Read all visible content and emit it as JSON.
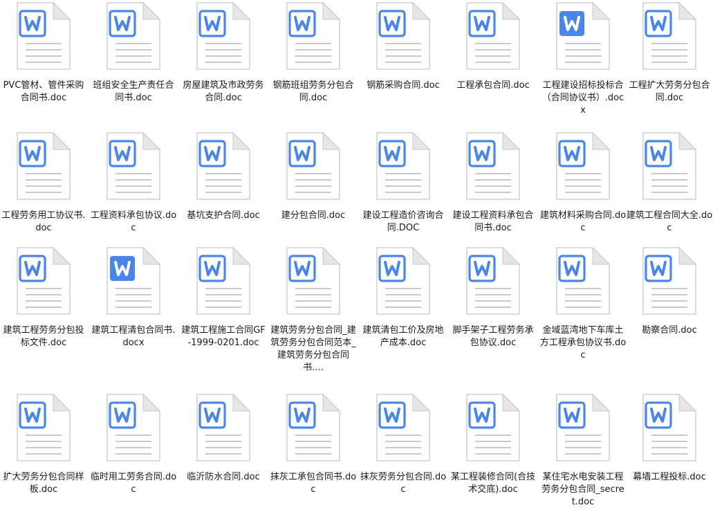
{
  "explorer": {
    "files": [
      {
        "name": "PVC管材、管件采购合同书.doc",
        "icon": "word-doc-icon"
      },
      {
        "name": "班组安全生产责任合同书.doc",
        "icon": "word-doc-icon"
      },
      {
        "name": "房屋建筑及市政劳务合同.doc",
        "icon": "word-doc-icon"
      },
      {
        "name": "钢筋班组劳务分包合同.doc",
        "icon": "word-doc-icon"
      },
      {
        "name": "钢筋采购合同.doc",
        "icon": "word-doc-icon"
      },
      {
        "name": "工程承包合同.doc",
        "icon": "word-doc-icon"
      },
      {
        "name": "工程建设招标投标合（合同协议书）.docx",
        "icon": "word-docx-icon"
      },
      {
        "name": "工程扩大劳务分包合同.doc",
        "icon": "word-doc-icon"
      },
      {
        "name": "工程劳务用工协议书.doc",
        "icon": "word-doc-icon"
      },
      {
        "name": "工程资料承包协议.doc",
        "icon": "word-doc-icon"
      },
      {
        "name": "基坑支护合同.doc",
        "icon": "word-doc-icon"
      },
      {
        "name": "建分包合同.doc",
        "icon": "word-doc-icon"
      },
      {
        "name": "建设工程造价咨询合同.DOC",
        "icon": "word-doc-icon"
      },
      {
        "name": "建设工程资料承包合同书.doc",
        "icon": "word-doc-icon"
      },
      {
        "name": "建筑材料采购合同.doc",
        "icon": "word-doc-icon"
      },
      {
        "name": "建筑工程合同大全.doc",
        "icon": "word-doc-icon"
      },
      {
        "name": "建筑工程劳务分包投标文件.doc",
        "icon": "word-doc-icon"
      },
      {
        "name": "建筑工程清包合同书.docx",
        "icon": "word-docx-icon"
      },
      {
        "name": "建筑工程施工合同GF-1999-0201.doc",
        "icon": "word-doc-icon"
      },
      {
        "name": "建筑劳务分包合同_建筑劳务分包合同范本_建筑劳务分包合同书....",
        "icon": "word-doc-icon"
      },
      {
        "name": "建筑清包工价及房地产成本.doc",
        "icon": "word-doc-icon"
      },
      {
        "name": "脚手架子工程劳务承包协议.doc",
        "icon": "word-doc-icon"
      },
      {
        "name": "金域蓝湾地下车库土方工程承包协议书.doc",
        "icon": "word-doc-icon"
      },
      {
        "name": "勘察合同.doc",
        "icon": "word-doc-icon"
      },
      {
        "name": "扩大劳务分包合同样板.doc",
        "icon": "word-doc-icon"
      },
      {
        "name": "临时用工劳务合同.doc",
        "icon": "word-doc-icon"
      },
      {
        "name": "临沂防水合同.doc",
        "icon": "word-doc-icon"
      },
      {
        "name": "抹灰工承包合同书.doc",
        "icon": "word-doc-icon"
      },
      {
        "name": "抹灰劳务分包合同.doc",
        "icon": "word-doc-icon"
      },
      {
        "name": "某工程装修合同(合技术交底).doc",
        "icon": "word-doc-icon"
      },
      {
        "name": "某住宅水电安装工程劳务分包合同_secret.doc",
        "icon": "word-doc-icon"
      },
      {
        "name": "幕墙工程投标.doc",
        "icon": "word-doc-icon"
      }
    ],
    "colors": {
      "doc_accent": "#4a86e8",
      "docx_fill": "#4a86e8",
      "page_fill": "#ffffff",
      "page_border": "#c8c8c8",
      "fold": "#e6e6e6",
      "lines": "#c8c8c8"
    }
  }
}
